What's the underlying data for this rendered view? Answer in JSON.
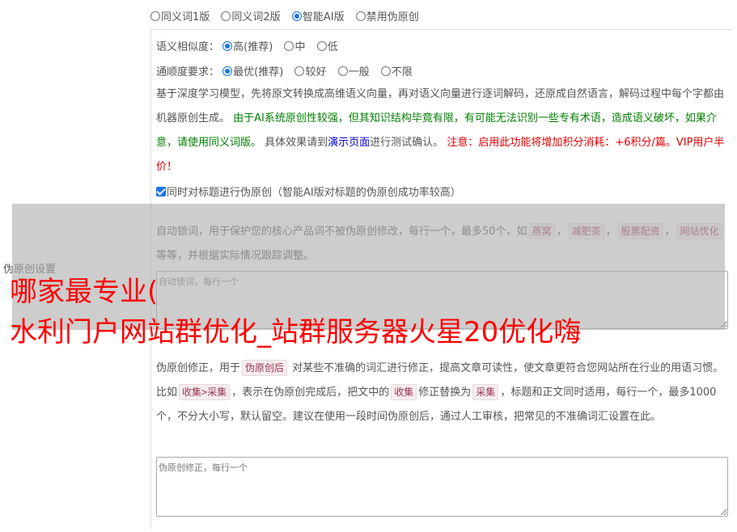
{
  "version_options": [
    {
      "label": "同义词1版",
      "checked": false
    },
    {
      "label": "同义词2版",
      "checked": false
    },
    {
      "label": "智能AI版",
      "checked": true
    },
    {
      "label": "禁用伪原创",
      "checked": false
    }
  ],
  "similarity": {
    "label": "语义相似度：",
    "options": [
      {
        "label": "高(推荐)",
        "checked": true
      },
      {
        "label": "中",
        "checked": false
      },
      {
        "label": "低",
        "checked": false
      }
    ]
  },
  "fluency": {
    "label": "通顺度要求：",
    "options": [
      {
        "label": "最优(推荐)",
        "checked": true
      },
      {
        "label": "较好",
        "checked": false
      },
      {
        "label": "一般",
        "checked": false
      },
      {
        "label": "不限",
        "checked": false
      }
    ]
  },
  "description": {
    "part1": "基于深度学习模型，先将原文转换成高维语义向量，再对语义向量进行逐词解码，还原成自然语言，解码过程中每个字都由机器原创生成。 ",
    "warning_green": "由于AI系统原创性较强，但其知识结构毕竟有限，有可能无法识别一些专有术语，造成语义破坏，如果介意，请使用同义词版。",
    "part2": " 具体效果请到",
    "demo_link": "演示页面",
    "part3": "进行测试确认。 ",
    "notice_red": "注意：启用此功能将增加积分消耗：+6积分/篇。VIP用户半价！"
  },
  "title_checkbox": {
    "label": "同时对标题进行伪原创（智能AI版对标题的伪原创成功率较高）",
    "checked": true
  },
  "lock_words": {
    "text1": "自动锁词，用于保护您的核心产品词不被伪原创修改，每行一个，最多50个，如",
    "examples": [
      "燕窝",
      "减肥茶",
      "股票配资",
      "网站优化"
    ],
    "sep1": "，",
    "sep2": "，",
    "sep3": "，",
    "text2": " 等等，并根据实际情况跟踪调整。",
    "placeholder": "自动锁词，每行一个"
  },
  "correction": {
    "text1": "伪原创修正，用于",
    "tag1": "伪原创后",
    "text2": " 对某些不准确的词汇进行修正，提高文章可读性，使文章更符合您网站所在行业的用语习惯。比如",
    "tag2": "收集>采集",
    "text3": "，表示在伪原创完成后，把文中的",
    "tag3": "收集",
    "text4": "修正替换为",
    "tag4": "采集",
    "text5": "，标题和正文同时适用，每行一个，最多1000个，不分大小写，默认留空。建议在使用一段时间伪原创后，通过人工审核，把常见的不准确词汇设置在此。",
    "placeholder": "伪原创修正，每行一个"
  },
  "side_label": "伪原创设置",
  "watermark": {
    "line1": "哪家最专业(",
    "line2": "水利门户网站群优化_站群服务器火星20优化嗨"
  }
}
